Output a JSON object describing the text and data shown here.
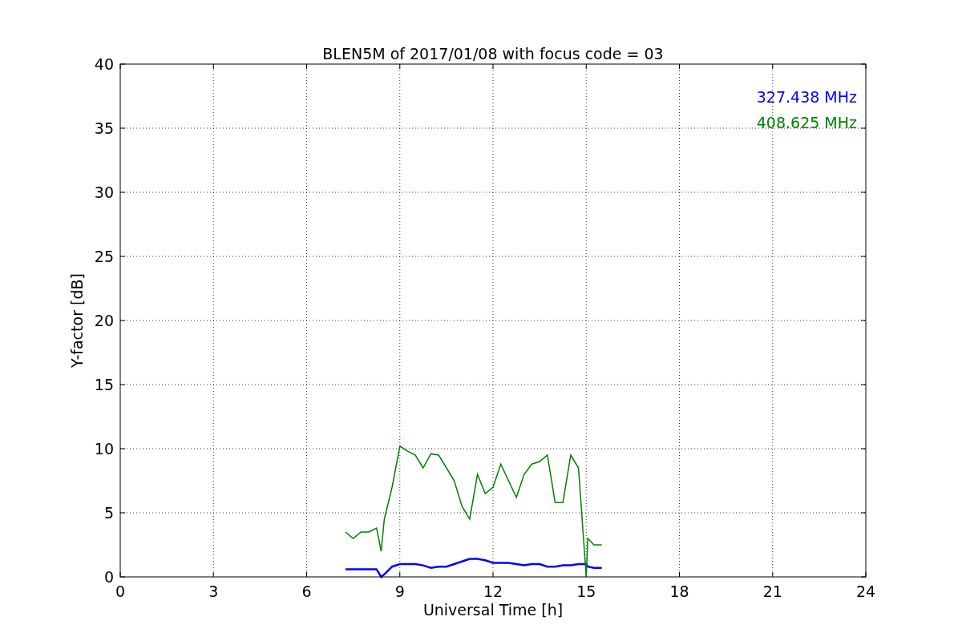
{
  "chart_data": {
    "type": "line",
    "title": "BLEN5M of 2017/01/08 with focus code = 03",
    "xlabel": "Universal Time [h]",
    "ylabel": "Y-factor [dB]",
    "x": [
      7.25,
      7.5,
      7.75,
      8.0,
      8.25,
      8.4,
      8.5,
      8.75,
      9.0,
      9.25,
      9.5,
      9.75,
      10.0,
      10.25,
      10.5,
      10.75,
      11.0,
      11.25,
      11.5,
      11.75,
      12.0,
      12.25,
      12.5,
      12.75,
      13.0,
      13.25,
      13.5,
      13.75,
      14.0,
      14.25,
      14.5,
      14.75,
      15.0,
      15.05,
      15.25,
      15.5
    ],
    "series": [
      {
        "name": "327.438 MHz",
        "color": "#0000ff",
        "values": [
          0.6,
          0.6,
          0.6,
          0.6,
          0.6,
          0,
          0.2,
          0.8,
          1.0,
          1.0,
          1.0,
          0.9,
          0.7,
          0.8,
          0.8,
          1.0,
          1.2,
          1.4,
          1.4,
          1.3,
          1.1,
          1.1,
          1.1,
          1.0,
          0.9,
          1.0,
          1.0,
          0.8,
          0.8,
          0.9,
          0.9,
          1.0,
          1.0,
          0.8,
          0.7,
          0.7
        ]
      },
      {
        "name": "408.625 MHz",
        "color": "#008000",
        "values": [
          3.5,
          3.0,
          3.5,
          3.5,
          3.8,
          2.0,
          4.5,
          7.0,
          10.2,
          9.8,
          9.5,
          8.5,
          9.6,
          9.5,
          8.5,
          7.5,
          5.5,
          4.5,
          8.0,
          6.5,
          7.0,
          8.8,
          7.5,
          6.2,
          8.0,
          8.8,
          9.0,
          9.5,
          5.8,
          5.8,
          9.5,
          8.5,
          0,
          3.0,
          2.5,
          2.5
        ]
      }
    ],
    "grid": true,
    "xlim": [
      0,
      24
    ],
    "ylim": [
      0,
      40
    ],
    "xticks": [
      0,
      3,
      6,
      9,
      12,
      15,
      18,
      21,
      24
    ],
    "yticks": [
      0,
      5,
      10,
      15,
      20,
      25,
      30,
      35,
      40
    ]
  }
}
